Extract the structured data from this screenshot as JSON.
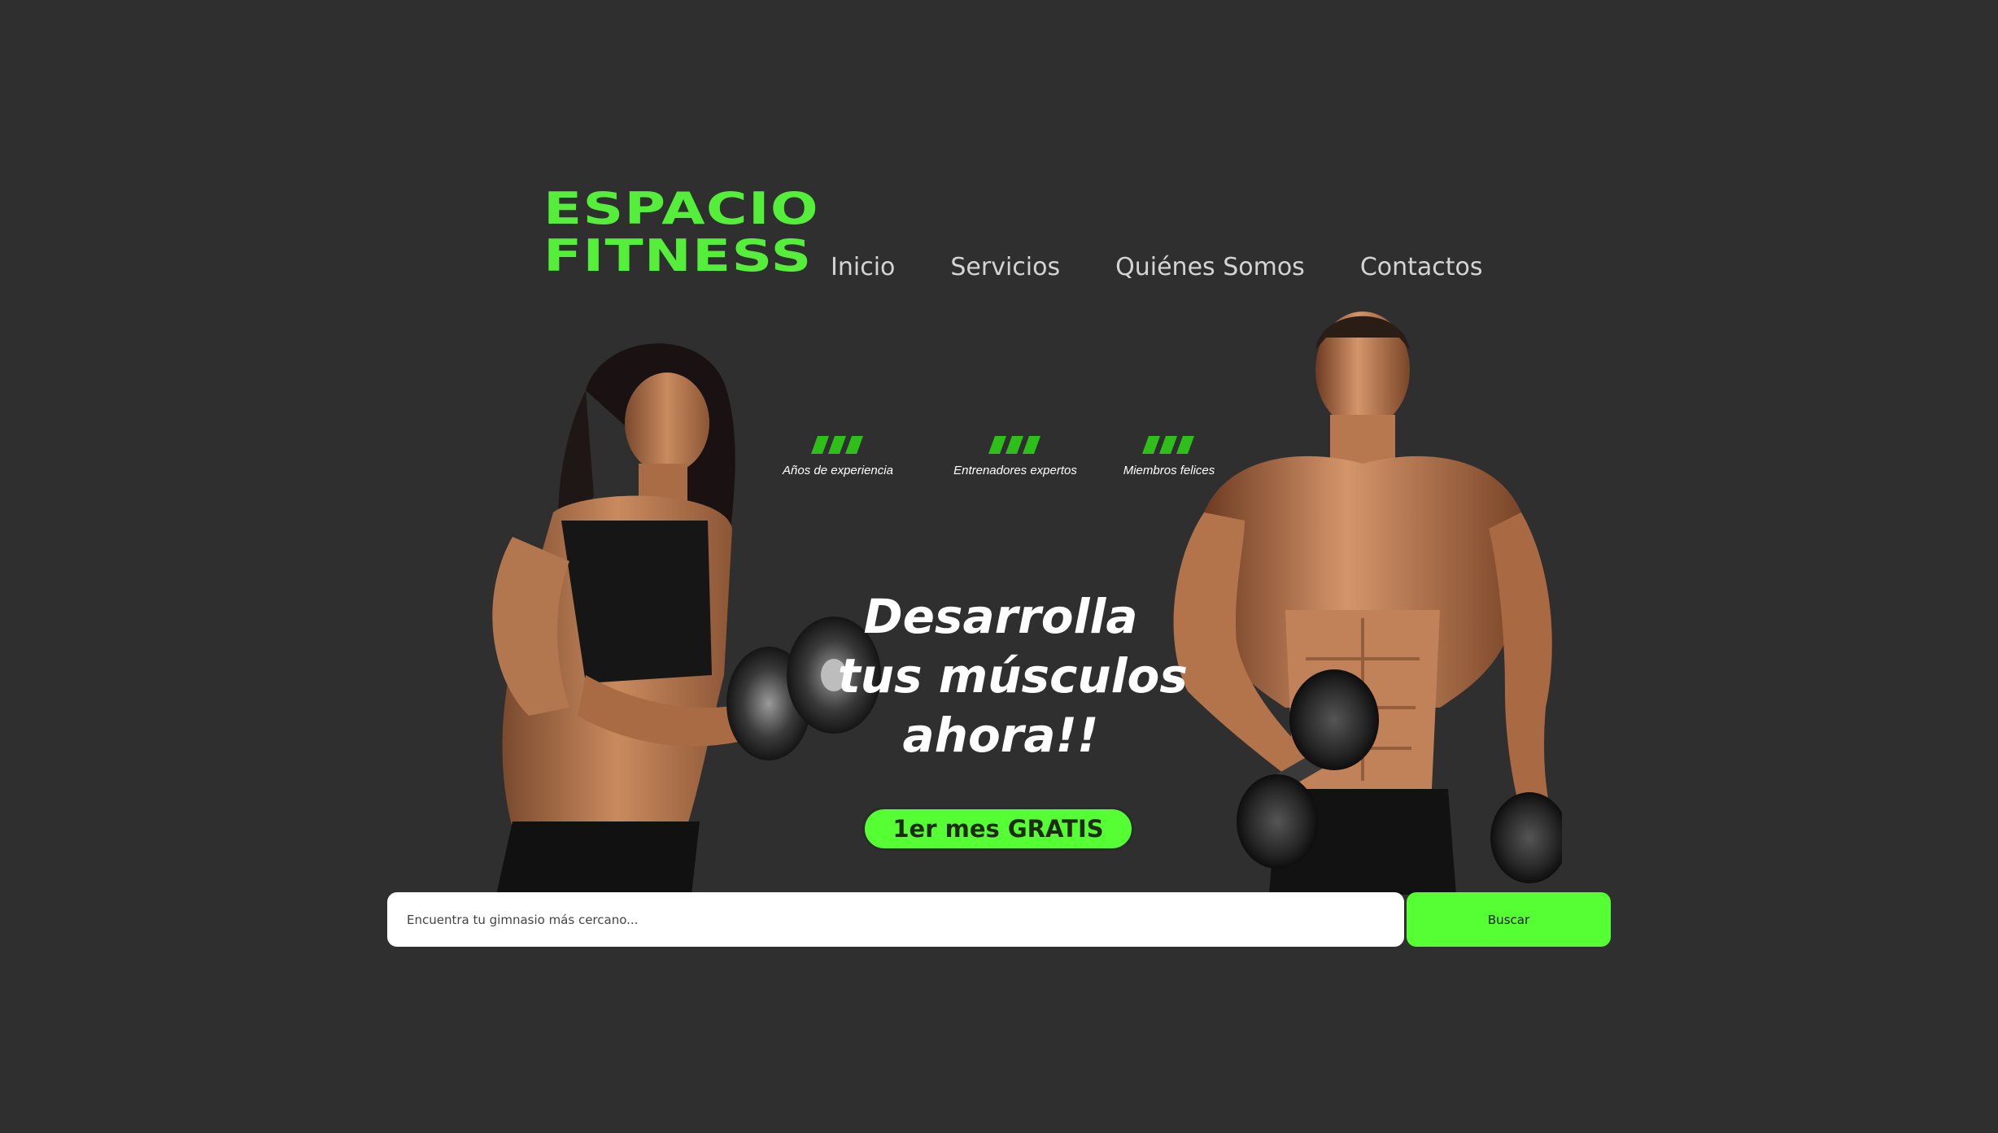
{
  "colors": {
    "background": "#2f2f2f",
    "accent": "#55ff33",
    "accent_dark": "#2fbf1b",
    "nav_text": "#d4d4d4",
    "hero_text": "#ffffff"
  },
  "logo": {
    "line1": "ESPACIO",
    "line2": "FITNESS"
  },
  "nav": {
    "items": [
      {
        "label": "Inicio"
      },
      {
        "label": "Servicios"
      },
      {
        "label": "Quiénes Somos"
      },
      {
        "label": "Contactos"
      }
    ]
  },
  "stats": [
    {
      "label": "Años de experiencia",
      "icon": "triple-slash-icon"
    },
    {
      "label": "Entrenadores expertos",
      "icon": "triple-slash-icon"
    },
    {
      "label": "Miembros felices",
      "icon": "triple-slash-icon"
    }
  ],
  "hero": {
    "line1": "Desarrolla",
    "line2": "tus músculos",
    "line3": "ahora!!",
    "cta_label": "1er mes GRATIS"
  },
  "search": {
    "placeholder": "Encuentra tu gimnasio más cercano...",
    "value": "",
    "button_label": "Buscar"
  }
}
